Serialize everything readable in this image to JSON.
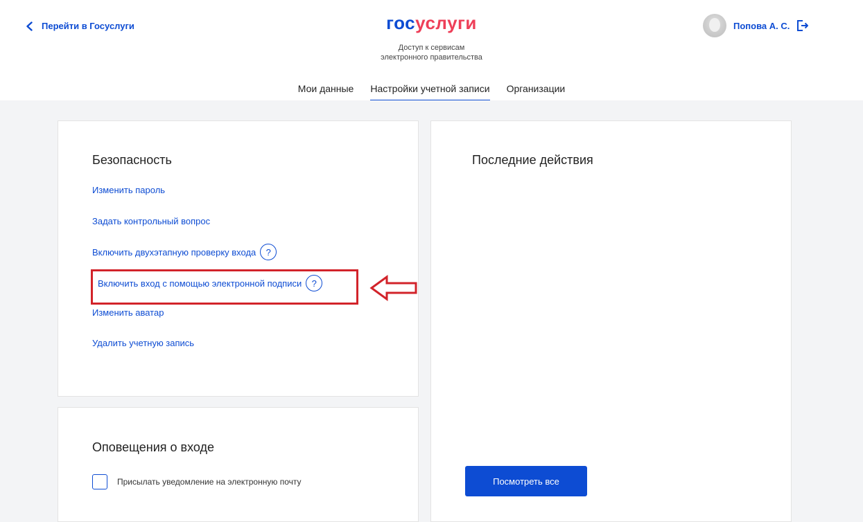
{
  "header": {
    "back_label": "Перейти в Госуслуги",
    "logo_part1": "гос",
    "logo_part2": "услуги",
    "subtitle_line1": "Доступ к сервисам",
    "subtitle_line2": "электронного правительства",
    "user_name": "Попова А. С.",
    "icons": [
      "chevron-left-icon",
      "avatar",
      "logout-icon"
    ]
  },
  "tabs": [
    {
      "label": "Мои данные",
      "active": false
    },
    {
      "label": "Настройки учетной записи",
      "active": true
    },
    {
      "label": "Организации",
      "active": false
    }
  ],
  "security": {
    "title": "Безопасность",
    "links": [
      {
        "label": "Изменить пароль",
        "help": false
      },
      {
        "label": "Задать контрольный вопрос",
        "help": false
      },
      {
        "label": "Включить двухэтапную проверку входа",
        "help": true
      },
      {
        "label": "Включить  вход с помощью электронной подписи",
        "help": true
      },
      {
        "label": "Изменить аватар",
        "help": false
      },
      {
        "label": "Удалить учетную запись",
        "help": false
      }
    ],
    "help_glyph": "?"
  },
  "actions": {
    "title": "Последние действия",
    "button_label": "Посмотреть все"
  },
  "notifications": {
    "title": "Оповещения о входе",
    "checkbox_label": "Присылать уведомление на электронную почту",
    "checked": false
  },
  "colors": {
    "brand_blue": "#0d4cd3",
    "brand_red": "#ee3f58",
    "highlight_red": "#d2232a",
    "background": "#f3f4f6"
  }
}
